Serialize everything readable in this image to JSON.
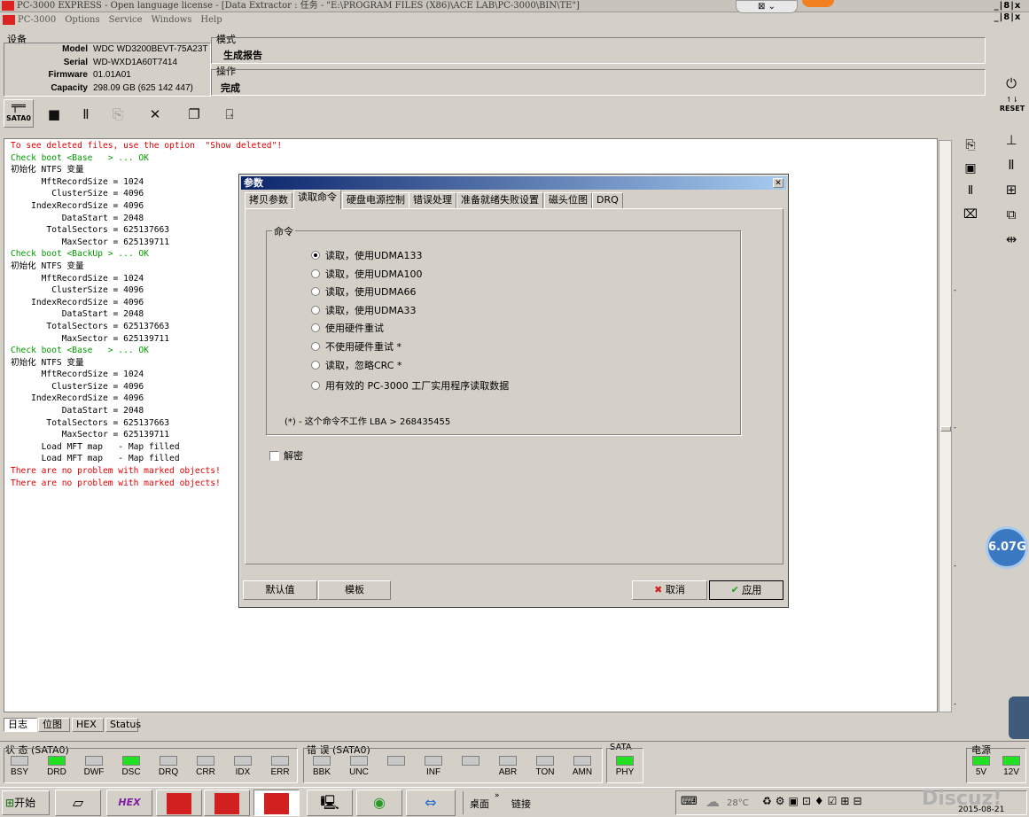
{
  "window": {
    "title": "PC-3000 EXPRESS - Open language license - [Data Extractor : 任务 - \"E:\\PROGRAM FILES (X86)\\ACE LAB\\PC-3000\\BIN\\TE\"]",
    "menu": [
      "PC-3000",
      "Options",
      "Service",
      "Windows",
      "Help"
    ],
    "controls": "_|8|x"
  },
  "device": {
    "label": "设备",
    "fields": [
      {
        "key": "Model",
        "value": "WDC WD3200BEVT-75A23T"
      },
      {
        "key": "Serial",
        "value": "WD-WXD1A60T7414"
      },
      {
        "key": "Firmware",
        "value": "01.01A01"
      },
      {
        "key": "Capacity",
        "value": "298.09 GB (625 142 447)"
      }
    ]
  },
  "mode": {
    "label": "模式",
    "value": "生成报告"
  },
  "operation": {
    "label": "操作",
    "value": "完成"
  },
  "toolbar": {
    "port_label": "SATA0"
  },
  "log": [
    {
      "text": "To see deleted files, use the option  \"Show deleted\"!",
      "color": "red"
    },
    {
      "text": "Check boot <Base   > ... OK",
      "color": "green"
    },
    {
      "text": "初始化 NTFS 变量",
      "color": "black"
    },
    {
      "text": "      MftRecordSize = 1024",
      "color": "black"
    },
    {
      "text": "        ClusterSize = 4096",
      "color": "black"
    },
    {
      "text": "    IndexRecordSize = 4096",
      "color": "black"
    },
    {
      "text": "          DataStart = 2048",
      "color": "black"
    },
    {
      "text": "       TotalSectors = 625137663",
      "color": "black"
    },
    {
      "text": "          MaxSector = 625139711",
      "color": "black"
    },
    {
      "text": "Check boot <BackUp > ... OK",
      "color": "green"
    },
    {
      "text": "初始化 NTFS 变量",
      "color": "black"
    },
    {
      "text": "      MftRecordSize = 1024",
      "color": "black"
    },
    {
      "text": "        ClusterSize = 4096",
      "color": "black"
    },
    {
      "text": "    IndexRecordSize = 4096",
      "color": "black"
    },
    {
      "text": "          DataStart = 2048",
      "color": "black"
    },
    {
      "text": "       TotalSectors = 625137663",
      "color": "black"
    },
    {
      "text": "          MaxSector = 625139711",
      "color": "black"
    },
    {
      "text": "Check boot <Base   > ... OK",
      "color": "green"
    },
    {
      "text": "初始化 NTFS 变量",
      "color": "black"
    },
    {
      "text": "      MftRecordSize = 1024",
      "color": "black"
    },
    {
      "text": "        ClusterSize = 4096",
      "color": "black"
    },
    {
      "text": "    IndexRecordSize = 4096",
      "color": "black"
    },
    {
      "text": "          DataStart = 2048",
      "color": "black"
    },
    {
      "text": "       TotalSectors = 625137663",
      "color": "black"
    },
    {
      "text": "          MaxSector = 625139711",
      "color": "black"
    },
    {
      "text": "      Load MFT map   - Map filled",
      "color": "black"
    },
    {
      "text": "      Load MFT map   - Map filled",
      "color": "black"
    },
    {
      "text": "There are no problem with marked objects!",
      "color": "red"
    },
    {
      "text": "There are no problem with marked objects!",
      "color": "red"
    }
  ],
  "bottom_tabs": [
    "日志",
    "位图",
    "HEX",
    "Status"
  ],
  "status_panel": {
    "label": "状 态 (SATA0)",
    "leds": [
      {
        "name": "BSY",
        "on": false
      },
      {
        "name": "DRD",
        "on": true
      },
      {
        "name": "DWF",
        "on": false
      },
      {
        "name": "DSC",
        "on": true
      },
      {
        "name": "DRQ",
        "on": false
      },
      {
        "name": "CRR",
        "on": false
      },
      {
        "name": "IDX",
        "on": false
      },
      {
        "name": "ERR",
        "on": false
      }
    ]
  },
  "error_panel": {
    "label": "错 误 (SATA0)",
    "leds": [
      {
        "name": "BBK",
        "on": false
      },
      {
        "name": "UNC",
        "on": false
      },
      {
        "name": "",
        "on": false
      },
      {
        "name": "INF",
        "on": false
      },
      {
        "name": "",
        "on": false
      },
      {
        "name": "ABR",
        "on": false
      },
      {
        "name": "TON",
        "on": false
      },
      {
        "name": "AMN",
        "on": false
      }
    ]
  },
  "sata_panel": {
    "label": "SATA",
    "led": {
      "name": "PHY",
      "on": true
    }
  },
  "power_panel": {
    "label": "电源",
    "leds": [
      {
        "name": "5V",
        "on": true
      },
      {
        "name": "12V",
        "on": true
      }
    ]
  },
  "right_toolbar": {
    "reset_label": "RESET"
  },
  "speed_badge": "6.07G",
  "dialog": {
    "title": "参数",
    "tabs": [
      "拷贝参数",
      "读取命令",
      "硬盘电源控制",
      "错误处理",
      "准备就绪失败设置",
      "磁头位图",
      "DRQ"
    ],
    "active_tab": 1,
    "group_label": "命令",
    "options": [
      {
        "label": "读取，使用UDMA133",
        "selected": true
      },
      {
        "label": "读取，使用UDMA100",
        "selected": false
      },
      {
        "label": "读取，使用UDMA66",
        "selected": false
      },
      {
        "label": "读取，使用UDMA33",
        "selected": false
      },
      {
        "label": "使用硬件重试",
        "selected": false
      },
      {
        "label": "不使用硬件重试 *",
        "selected": false
      },
      {
        "label": "读取，忽略CRC *",
        "selected": false
      },
      {
        "label": "用有效的 PC-3000 工厂实用程序读取数据",
        "selected": false
      }
    ],
    "note": "(*) - 这个命令不工作 LBA > 268435455",
    "decrypt_label": "解密",
    "decrypt_checked": false,
    "buttons": {
      "default": "默认值",
      "template": "模板",
      "cancel": "取消",
      "apply": "应用"
    }
  },
  "taskbar": {
    "start": "开始",
    "desktop": "桌面",
    "links": "链接",
    "weather": "28°C",
    "date": "2015-08-21",
    "watermark": "Discuz!"
  }
}
